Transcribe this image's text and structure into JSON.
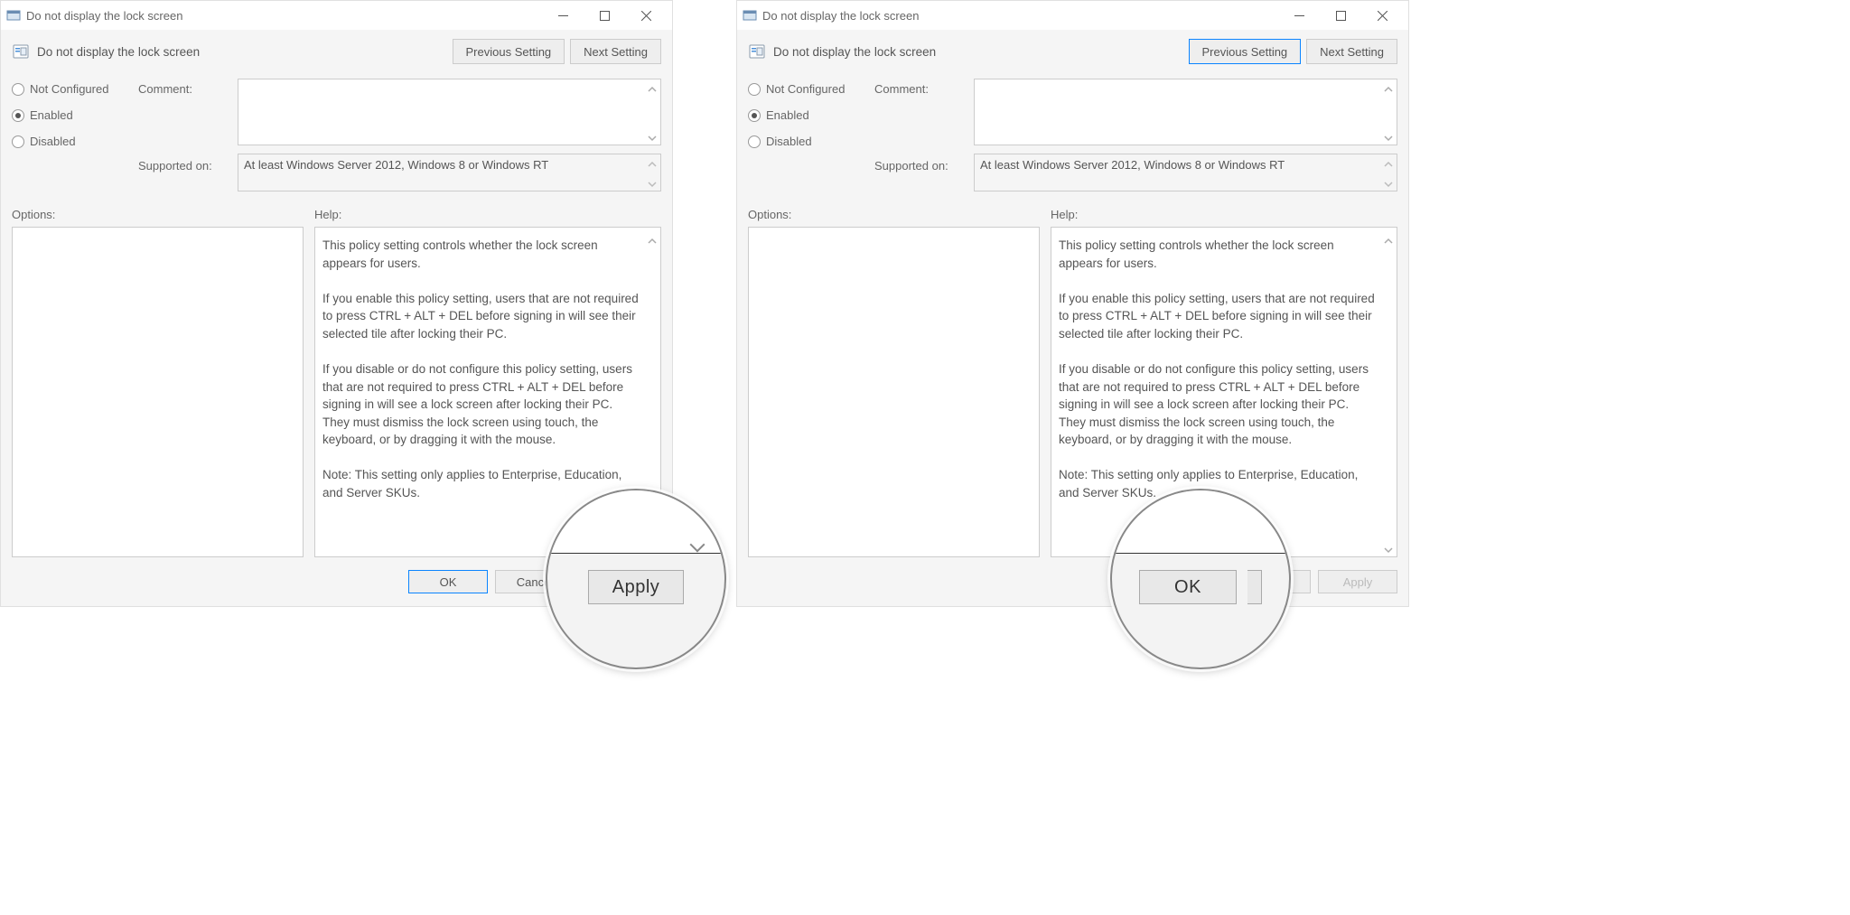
{
  "shared": {
    "window_title": "Do not display the lock screen",
    "header_title": "Do not display the lock screen",
    "nav": {
      "prev": "Previous Setting",
      "next": "Next Setting"
    },
    "radios": {
      "not_configured": "Not Configured",
      "enabled": "Enabled",
      "disabled": "Disabled"
    },
    "comment_label": "Comment:",
    "supported_label": "Supported on:",
    "supported_text": "At least Windows Server 2012, Windows 8 or Windows RT",
    "options_label": "Options:",
    "help_label": "Help:",
    "help_p1": "This policy setting controls whether the lock screen appears for users.",
    "help_p2": "If you enable this policy setting, users that are not required to press CTRL + ALT + DEL before signing in will see their selected tile after locking their PC.",
    "help_p3": "If you disable or do not configure this policy setting, users that are not required to press CTRL + ALT + DEL before signing in will see a lock screen after locking their PC. They must dismiss the lock screen using touch, the keyboard, or by dragging it with the mouse.",
    "help_p4": "Note: This setting only applies to Enterprise, Education, and Server SKUs.",
    "footer": {
      "ok": "OK",
      "cancel": "Cancel",
      "apply": "Apply"
    }
  },
  "left": {
    "zoom_label": "Apply"
  },
  "right": {
    "zoom_label": "OK"
  }
}
